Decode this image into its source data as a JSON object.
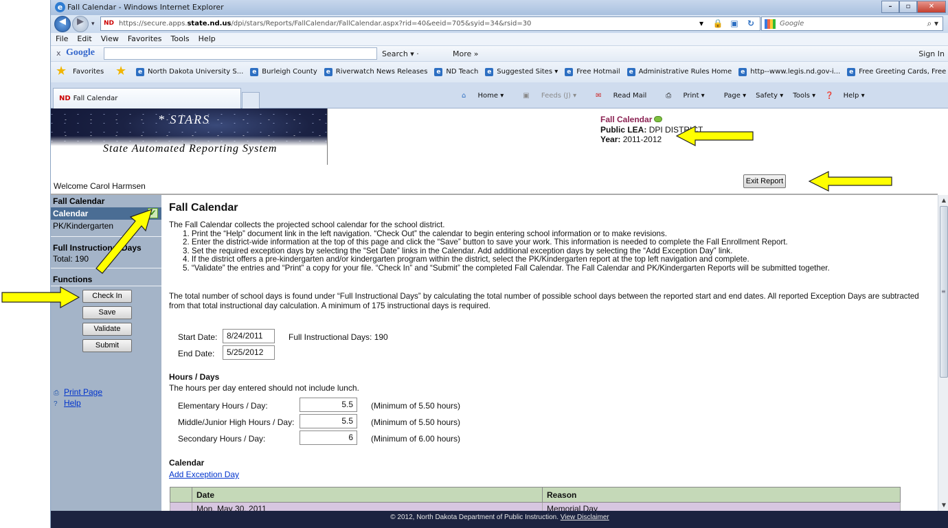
{
  "browser": {
    "window_title": "Fall Calendar - Windows Internet Explorer",
    "url_prefix": "https://secure.apps.",
    "url_domain": "state.nd.us",
    "url_suffix": "/dpi/stars/Reports/FallCalendar/FallCalendar.aspx?rid=40&eeid=705&syid=34&rsid=30",
    "search_placeholder": "Google",
    "menu": [
      "File",
      "Edit",
      "View",
      "Favorites",
      "Tools",
      "Help"
    ],
    "google_bar": {
      "logo": "Google",
      "search_label": "Search ▾ ·",
      "more_label": "More »",
      "sign_in": "Sign In"
    },
    "favorites_label": "Favorites",
    "favorites": [
      "North Dakota University S...",
      "Burleigh County",
      "Riverwatch News Releases",
      "ND Teach",
      "Suggested Sites ▾",
      "Free Hotmail",
      "Administrative Rules Home",
      "http--www.legis.nd.gov-i...",
      "Free Greeting Cards, Free ..."
    ],
    "tab_label": "Fall Calendar",
    "commands": {
      "home": "Home ▾",
      "feeds": "Feeds (J) ▾",
      "read_mail": "Read Mail",
      "print": "Print ▾",
      "page": "Page ▾",
      "safety": "Safety ▾",
      "tools": "Tools ▾",
      "help": "Help ▾"
    }
  },
  "header": {
    "brand_stars": "* STARS",
    "brand_full": "State Automated Reporting System",
    "report_title": "Fall Calendar",
    "lea_label": "Public LEA:",
    "lea_value": "DPI DISTRICT",
    "year_label": "Year:",
    "year_value": "2011-2012",
    "welcome": "Welcome Carol Harmsen",
    "exit_button": "Exit Report"
  },
  "sidebar": {
    "section_fall": "Fall Calendar",
    "calendar_item": "Calendar",
    "pk_item": "PK/Kindergarten",
    "section_days": "Full Instructional Days",
    "total": "Total:  190",
    "section_functions": "Functions",
    "buttons": {
      "check_in": "Check In",
      "save": "Save",
      "validate": "Validate",
      "submit": "Submit"
    },
    "print_page": "Print Page",
    "help": "Help"
  },
  "main": {
    "title": "Fall Calendar",
    "intro": "The Fall Calendar collects the projected school calendar for the school district.",
    "steps": [
      "1. Print the “Help” document link in the left navigation. “Check Out” the calendar to begin entering school information or to make revisions.",
      "2. Enter the district-wide information at the top of this page and click the “Save” button to save your work. This information is needed to complete the Fall Enrollment Report.",
      "3. Set the required exception days by selecting the “Set Date” links in the Calendar. Add additional exception days by selecting the “Add Exception Day” link.",
      "4. If the district offers a pre-kindergarten and/or kindergarten program within the district, select the PK/Kindergarten report at the top left navigation and complete.",
      "5. “Validate” the entries and “Print” a copy for your file. “Check In” and “Submit” the completed Fall Calendar. The Fall Calendar and PK/Kindergarten Reports will be submitted together."
    ],
    "total_text": "The total number of school days is found under “Full Instructional Days” by calculating the total number of possible school days between the reported start and end dates. All reported Exception Days are subtracted from that total instructional day calculation. A minimum of 175 instructional days is required.",
    "start_label": "Start Date:",
    "start_value": "8/24/2011",
    "full_days": "Full Instructional Days: 190",
    "end_label": "End Date:",
    "end_value": "5/25/2012",
    "hours_heading": "Hours / Days",
    "hours_note": "The hours per day entered should not include lunch.",
    "hours": [
      {
        "label": "Elementary Hours / Day:",
        "value": "5.5",
        "min": "(Minimum of 5.50 hours)"
      },
      {
        "label": "Middle/Junior High Hours / Day:",
        "value": "5.5",
        "min": "(Minimum of 5.50 hours)"
      },
      {
        "label": "Secondary Hours / Day:",
        "value": "6",
        "min": "(Minimum of 6.00 hours)"
      }
    ],
    "calendar_heading": "Calendar",
    "add_exception": "Add Exception Day",
    "table": {
      "headers": [
        "Date",
        "Reason"
      ],
      "rows": [
        {
          "date": "Mon, May 30, 2011",
          "reason": "Memorial Day"
        }
      ]
    }
  },
  "footer": {
    "text": "© 2012, North Dakota Department of Public Instruction.",
    "link": "View Disclaimer"
  },
  "colors": {
    "sidebar_bg": "#a4b4c8",
    "selected_item": "#4a6d94",
    "table_header": "#c5d9b8",
    "table_row": "#d7c6e0",
    "footer_bg": "#1c2340",
    "arrow": "#ffff00"
  }
}
